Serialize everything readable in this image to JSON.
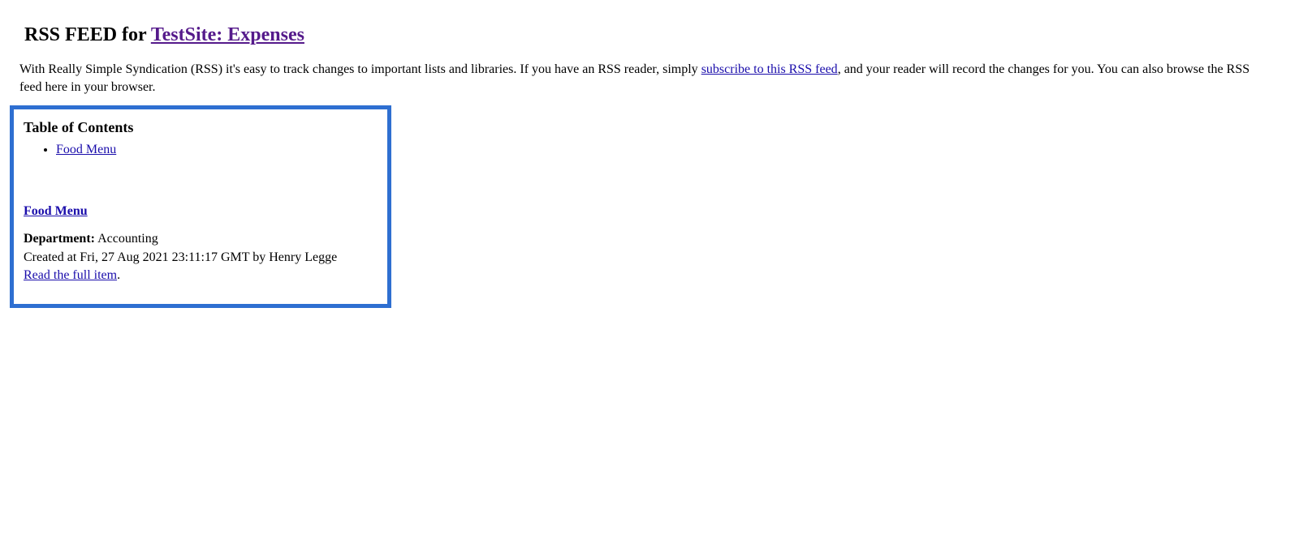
{
  "header": {
    "prefix": "RSS FEED for ",
    "site_link": "TestSite: Expenses"
  },
  "intro": {
    "before": "With Really Simple Syndication (RSS) it's easy to track changes to important lists and libraries. If you have an RSS reader, simply ",
    "link": "subscribe to this RSS feed",
    "after": ", and your reader will record the changes for you. You can also browse the RSS feed here in your browser."
  },
  "toc": {
    "title": "Table of Contents",
    "items": [
      {
        "label": "Food Menu"
      }
    ]
  },
  "item": {
    "title": "Food Menu",
    "department_label": "Department:",
    "department_value": " Accounting",
    "created_line": "Created at Fri, 27 Aug 2021 23:11:17 GMT by Henry Legge",
    "read_full": "Read the full item",
    "period": "."
  }
}
